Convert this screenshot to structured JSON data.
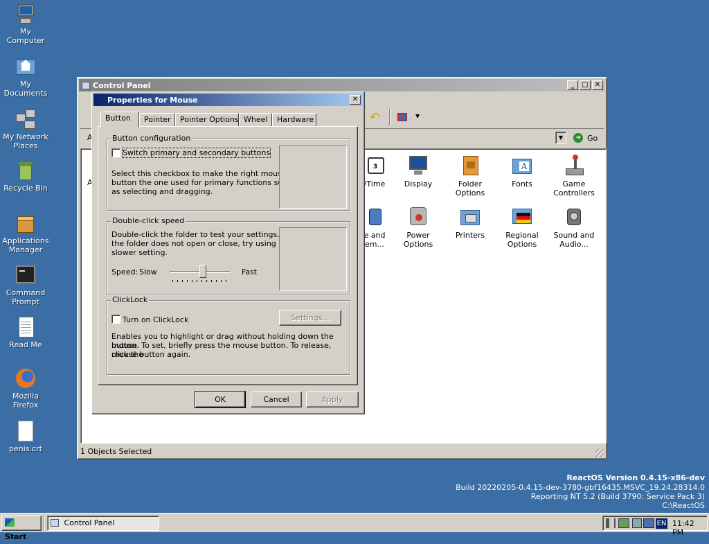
{
  "desktop": {
    "icons": [
      {
        "label_1": "My",
        "label_2": "Computer",
        "icon": "computer-icon"
      },
      {
        "label_1": "My",
        "label_2": "Documents",
        "icon": "folder-home-icon"
      },
      {
        "label_1": "My Network",
        "label_2": "Places",
        "icon": "network-icon"
      },
      {
        "label_1": "Recycle Bin",
        "label_2": "",
        "icon": "recycle-bin-icon"
      },
      {
        "label_1": "Applications",
        "label_2": "Manager",
        "icon": "package-icon"
      },
      {
        "label_1": "Command",
        "label_2": "Prompt",
        "icon": "terminal-icon"
      },
      {
        "label_1": "Read Me",
        "label_2": "",
        "icon": "text-file-icon"
      },
      {
        "label_1": "Mozilla",
        "label_2": "Firefox",
        "icon": "firefox-icon"
      },
      {
        "label_1": "penis.crt",
        "label_2": "",
        "icon": "certificate-file-icon"
      }
    ]
  },
  "control_panel": {
    "title": "Control Panel",
    "address_prefix": "A",
    "go_label": "Go",
    "left_letter": "A",
    "status": "1 Objects Selected",
    "items": [
      {
        "line1": "/Time",
        "line2": "",
        "icon": "clock-icon"
      },
      {
        "line1": "Display",
        "line2": "",
        "icon": "display-icon"
      },
      {
        "line1": "Folder",
        "line2": "Options",
        "icon": "folder-options-icon"
      },
      {
        "line1": "Fonts",
        "line2": "",
        "icon": "fonts-icon"
      },
      {
        "line1": "Game",
        "line2": "Controllers",
        "icon": "joystick-icon"
      },
      {
        "line1": "e and",
        "line2": "em...",
        "icon": "phone-icon"
      },
      {
        "line1": "Power",
        "line2": "Options",
        "icon": "power-icon"
      },
      {
        "line1": "Printers",
        "line2": "",
        "icon": "printer-icon"
      },
      {
        "line1": "Regional",
        "line2": "Options",
        "icon": "flag-icon"
      },
      {
        "line1": "Sound and",
        "line2": "Audio...",
        "icon": "speaker-icon"
      }
    ]
  },
  "dialog": {
    "title": "Properties for Mouse",
    "tabs": [
      "Button",
      "Pointer",
      "Pointer Options",
      "Wheel",
      "Hardware"
    ],
    "button_config": {
      "group_label": "Button configuration",
      "checkbox_label": "Switch primary and secondary buttons",
      "description_1": "Select this checkbox to make the right mouse",
      "description_2": "button the one used for primary functions such",
      "description_3": "as selecting and dragging."
    },
    "double_click": {
      "group_label": "Double-click speed",
      "description_1": "Double-click the folder to test your settings. If",
      "description_2": "the folder does not open or close, try using a",
      "description_3": "slower setting.",
      "speed_label": "Speed:",
      "slow_label": "Slow",
      "fast_label": "Fast",
      "slider_value": 0.55
    },
    "clicklock": {
      "group_label": "ClickLock",
      "checkbox_label": "Turn on ClickLock",
      "settings_button": "Settings...",
      "description_1": "Enables you to highlight or drag without holding down the mouse",
      "description_2": "button. To set, briefly press the mouse button. To release, click the",
      "description_3": "mouse button again."
    },
    "ok_label": "OK",
    "cancel_label": "Cancel",
    "apply_label": "Apply"
  },
  "watermark": {
    "line1": "ReactOS Version 0.4.15-x86-dev",
    "line2": "Build 20220205-0.4.15-dev-3780-gbf16435.MSVC_19.24.28314.0",
    "line3": "Reporting NT 5.2 (Build 3790: Service Pack 3)",
    "line4": "C:\\ReactOS"
  },
  "taskbar": {
    "start_label": "Start",
    "task_label": "Control Panel",
    "language": "EN",
    "clock": "11:42 PM"
  }
}
